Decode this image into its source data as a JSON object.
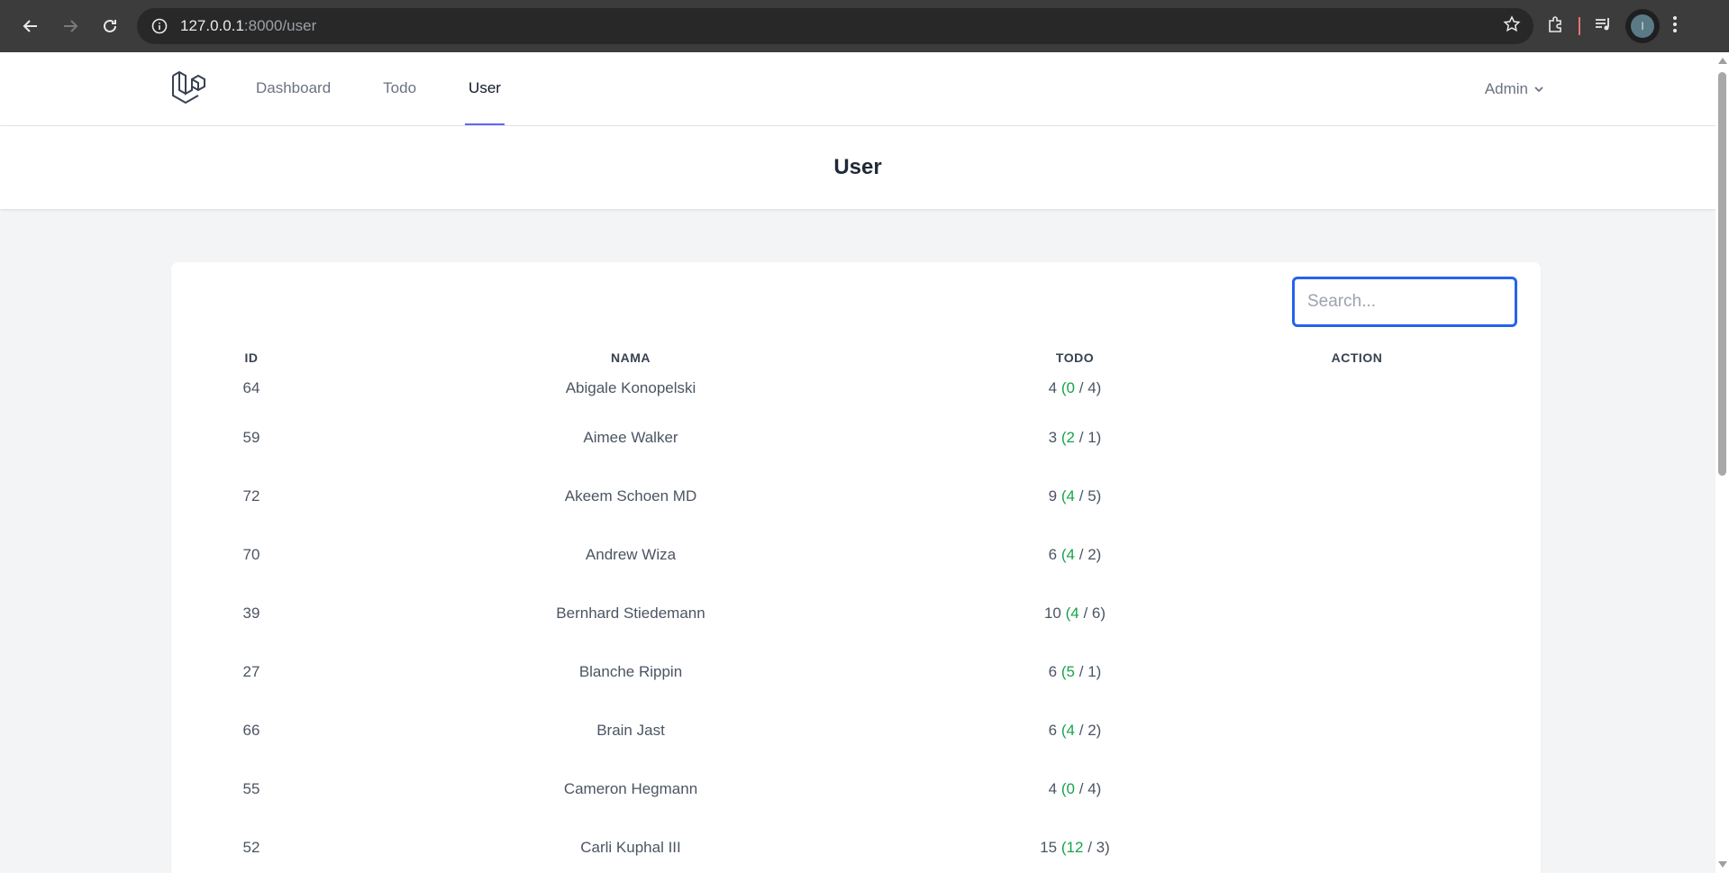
{
  "browser": {
    "url_host": "127.0.0.1",
    "url_path": ":8000/user",
    "profile_initial": "I"
  },
  "nav": {
    "links": [
      {
        "label": "Dashboard",
        "active": false
      },
      {
        "label": "Todo",
        "active": false
      },
      {
        "label": "User",
        "active": true
      }
    ],
    "user_name": "Admin"
  },
  "header": {
    "title": "User"
  },
  "search": {
    "placeholder": "Search..."
  },
  "table": {
    "headers": [
      "ID",
      "NAMA",
      "TODO",
      "ACTION"
    ],
    "rows": [
      {
        "id": "64",
        "name": "Abigale Konopelski",
        "total": "4",
        "done": "0",
        "pending": "4"
      },
      {
        "id": "59",
        "name": "Aimee Walker",
        "total": "3",
        "done": "2",
        "pending": "1"
      },
      {
        "id": "72",
        "name": "Akeem Schoen MD",
        "total": "9",
        "done": "4",
        "pending": "5"
      },
      {
        "id": "70",
        "name": "Andrew Wiza",
        "total": "6",
        "done": "4",
        "pending": "2"
      },
      {
        "id": "39",
        "name": "Bernhard Stiedemann",
        "total": "10",
        "done": "4",
        "pending": "6"
      },
      {
        "id": "27",
        "name": "Blanche Rippin",
        "total": "6",
        "done": "5",
        "pending": "1"
      },
      {
        "id": "66",
        "name": "Brain Jast",
        "total": "6",
        "done": "4",
        "pending": "2"
      },
      {
        "id": "55",
        "name": "Cameron Hegmann",
        "total": "4",
        "done": "0",
        "pending": "4"
      },
      {
        "id": "52",
        "name": "Carli Kuphal III",
        "total": "15",
        "done": "12",
        "pending": "3"
      }
    ]
  },
  "colors": {
    "accent": "#6366f1",
    "focus": "#2563eb",
    "done": "#16a34a"
  }
}
